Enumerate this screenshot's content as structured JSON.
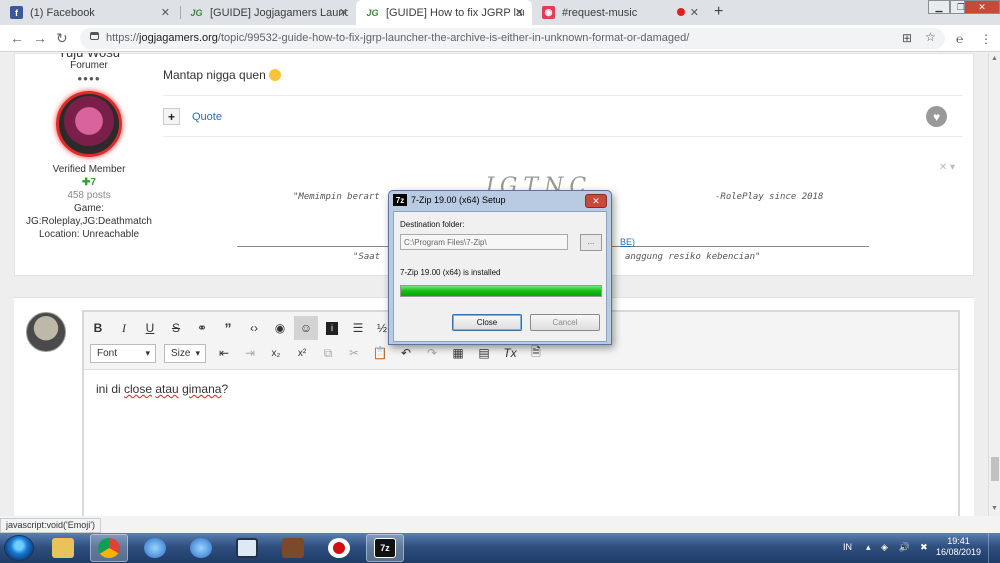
{
  "browser": {
    "tabs": [
      {
        "label": "(1) Facebook",
        "favicon": "f",
        "color": "#3b5998"
      },
      {
        "label": "[GUIDE] Jogjagamers Launcher [d",
        "favicon": "JG",
        "color": "#3a8a3a"
      },
      {
        "label": "[GUIDE] How to fix JGRP launche",
        "favicon": "JG",
        "color": "#3a8a3a"
      },
      {
        "label": "#request-music",
        "favicon": "●",
        "color": "#e33b54"
      }
    ],
    "url_prefix": "https://",
    "url_domain": "jogjagamers.org",
    "url_path": "/topic/99532-guide-how-to-fix-jgrp-launcher-the-archive-is-either-in-unknown-format-or-damaged/"
  },
  "post": {
    "author_role": "Forumer",
    "pips": "●●●●",
    "member_title": "Verified Member",
    "reputation": "7",
    "posts_count": "458 posts",
    "game_label": "Game:",
    "game_value": "JG:Roleplay,JG:Deathmatch",
    "location": "Location: Unreachable",
    "body_text": "Mantap nigga quen",
    "quote_label": "Quote",
    "sig_line1_left": "\"Memimpin berart",
    "sig_line1_right": "-RolePlay since 2018",
    "sig_link_text": "BE)",
    "sig_line2_left": "\"Saat",
    "sig_line2_right": "anggung resiko kebencian\""
  },
  "editor": {
    "font_label": "Font",
    "size_label": "Size",
    "content_text_1": "ini di ",
    "content_squig_1": "close",
    "content_text_2": " ",
    "content_squig_2": "atau",
    "content_text_3": " ",
    "content_squig_3": "gimana",
    "content_text_4": "?"
  },
  "dialog": {
    "title": "7-Zip 19.00 (x64) Setup",
    "logo": "7z",
    "destination_label": "Destination folder:",
    "destination_path": "C:\\Program Files\\7-Zip\\",
    "browse_label": "...",
    "status_text": "7-Zip 19.00 (x64) is installed",
    "progress_percent": 100,
    "close_label": "Close",
    "cancel_label": "Cancel"
  },
  "statusbar": {
    "text": "javascript:void('Emoji')"
  },
  "taskbar": {
    "language": "IN",
    "time": "19:41",
    "date": "16/08/2019"
  },
  "colors": {
    "progress": "#10c010",
    "link": "#2e6ab3",
    "avatar_border": "#e02a2a"
  }
}
